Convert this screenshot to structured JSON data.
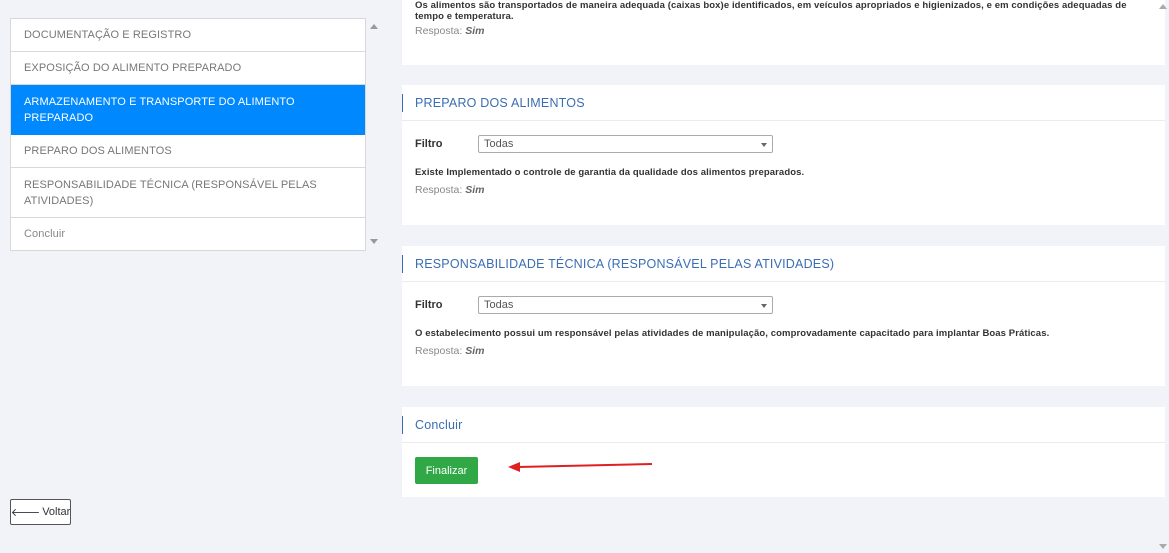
{
  "nav": {
    "items": [
      {
        "label": "DOCUMENTAÇÃO E REGISTRO"
      },
      {
        "label": "EXPOSIÇÃO DO ALIMENTO PREPARADO"
      },
      {
        "label": "ARMAZENAMENTO E TRANSPORTE DO ALIMENTO PREPARADO"
      },
      {
        "label": "PREPARO DOS ALIMENTOS"
      },
      {
        "label": "RESPONSABILIDADE TÉCNICA (RESPONSÁVEL PELAS ATIVIDADES)"
      },
      {
        "label": "Concluir"
      }
    ],
    "active_index": 2
  },
  "back_button": {
    "label": "Voltar"
  },
  "top_section": {
    "question": "Os alimentos são transportados de maneira adequada (caixas box)e identificados, em veículos apropriados e higienizados, e em condições adequadas de tempo e temperatura.",
    "answer_label": "Resposta:",
    "answer_value": "Sim"
  },
  "sections": [
    {
      "title": "PREPARO DOS ALIMENTOS",
      "filter_label": "Filtro",
      "filter_value": "Todas",
      "question": "Existe Implementado o controle de garantia da qualidade dos alimentos preparados.",
      "answer_label": "Resposta:",
      "answer_value": "Sim"
    },
    {
      "title": "RESPONSABILIDADE TÉCNICA (RESPONSÁVEL PELAS ATIVIDADES)",
      "filter_label": "Filtro",
      "filter_value": "Todas",
      "question": "O estabelecimento possui um responsável pelas atividades de manipulação, comprovadamente capacitado para implantar Boas Práticas.",
      "answer_label": "Resposta:",
      "answer_value": "Sim"
    }
  ],
  "conclude": {
    "title": "Concluir",
    "button_label": "Finalizar"
  },
  "colors": {
    "active_nav": "#0088ff",
    "section_title": "#3b6db3",
    "finalize_button": "#2fa845",
    "annotation_arrow": "#e02020"
  }
}
